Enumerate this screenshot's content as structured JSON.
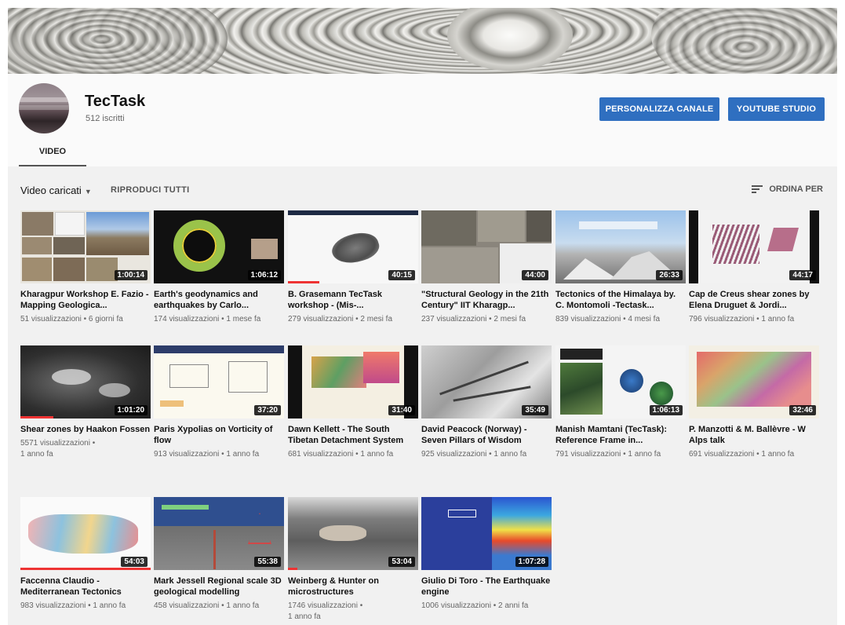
{
  "channel": {
    "name": "TecTask",
    "subscribers": "512 iscritti",
    "customize_button": "PERSONALIZZA CANALE",
    "studio_button": "YOUTUBE STUDIO",
    "tab_video": "VIDEO"
  },
  "toolbar": {
    "uploads_label": "Video caricati",
    "play_all_label": "RIPRODUCI TUTTI",
    "sort_label": "ORDINA PER"
  },
  "colors": {
    "primary_button": "#2f6fc0",
    "progress": "#e33"
  },
  "videos": [
    {
      "title": "Kharagpur Workshop E. Fazio - Mapping Geologica...",
      "meta": "51 visualizzazioni • 6 giorni fa",
      "duration": "1:00:14"
    },
    {
      "title": "Earth's geodynamics and earthquakes by Carlo...",
      "meta": "174 visualizzazioni • 1 mese fa",
      "duration": "1:06:12"
    },
    {
      "title": "B. Grasemann TecTask workshop - (Mis-...",
      "meta": "279 visualizzazioni • 2 mesi fa",
      "duration": "40:15"
    },
    {
      "title": "\"Structural Geology in the 21th Century\" IIT Kharagp...",
      "meta": "237 visualizzazioni • 2 mesi fa",
      "duration": "44:00"
    },
    {
      "title": "Tectonics of the Himalaya by. C. Montomoli -Tectask...",
      "meta": "839 visualizzazioni • 4 mesi fa",
      "duration": "26:33"
    },
    {
      "title": "Cap de Creus shear zones by Elena Druguet & Jordi...",
      "meta": "796 visualizzazioni • 1 anno fa",
      "duration": "44:17"
    },
    {
      "title": "Shear zones by Haakon Fossen",
      "meta": "5571 visualizzazioni •",
      "meta2": "1 anno fa",
      "duration": "1:01:20"
    },
    {
      "title": "Paris Xypolias on Vorticity of flow",
      "meta": "913 visualizzazioni • 1 anno fa",
      "duration": "37:20"
    },
    {
      "title": "Dawn Kellett - The South Tibetan Detachment System",
      "meta": "681 visualizzazioni • 1 anno fa",
      "duration": "31:40"
    },
    {
      "title": "David Peacock (Norway) - Seven Pillars of Wisdom",
      "meta": "925 visualizzazioni • 1 anno fa",
      "duration": "35:49"
    },
    {
      "title": "Manish Mamtani (TecTask): Reference Frame in...",
      "meta": "791 visualizzazioni • 1 anno fa",
      "duration": "1:06:13"
    },
    {
      "title": "P. Manzotti & M. Ballèvre - W Alps talk",
      "meta": "691 visualizzazioni • 1 anno fa",
      "duration": "32:46"
    },
    {
      "title": "Faccenna Claudio - Mediterranean Tectonics",
      "meta": "983 visualizzazioni • 1 anno fa",
      "duration": "54:03"
    },
    {
      "title": "Mark Jessell Regional scale 3D geological modelling",
      "meta": "458 visualizzazioni • 1 anno fa",
      "duration": "55:38"
    },
    {
      "title": "Weinberg & Hunter on microstructures",
      "meta": "1746 visualizzazioni •",
      "meta2": "1 anno fa",
      "duration": "53:04"
    },
    {
      "title": "Giulio Di Toro - The Earthquake engine",
      "meta": "1006 visualizzazioni • 2 anni fa",
      "duration": "1:07:28"
    }
  ]
}
